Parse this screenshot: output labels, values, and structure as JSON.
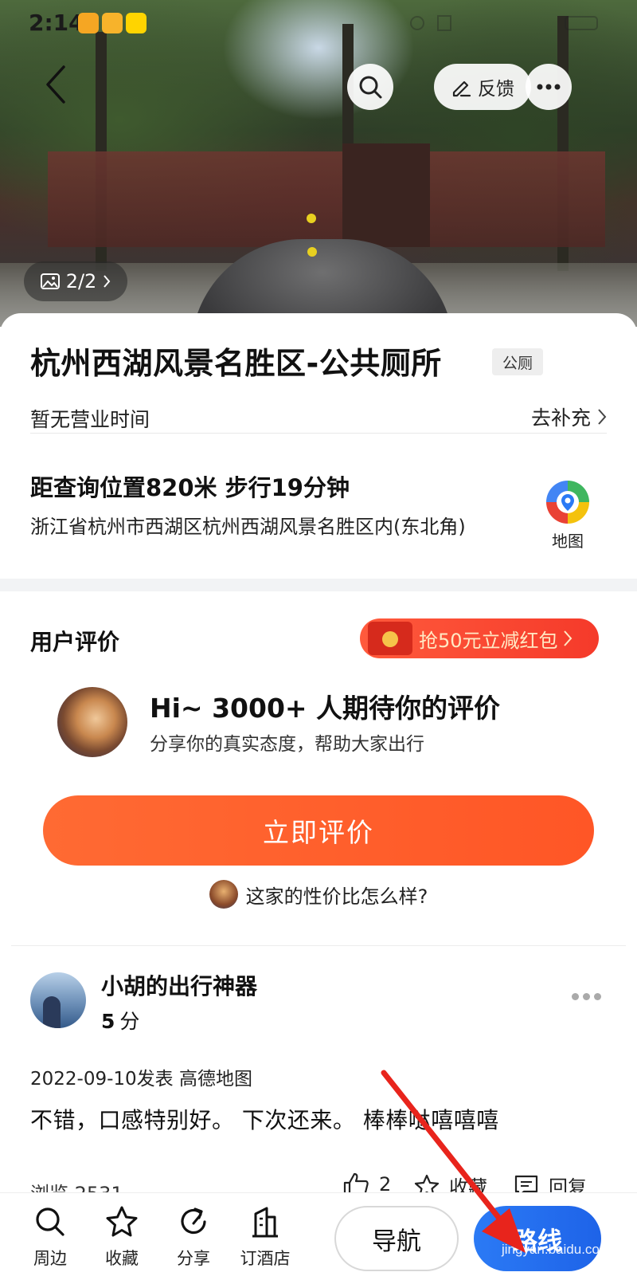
{
  "status_bar": {
    "time": "2:14",
    "app_badges": [
      {
        "icon": "message-app-icon",
        "color": "#f5a623"
      },
      {
        "icon": "delivery-app-icon",
        "color": "#f5a623"
      },
      {
        "icon": "xianyu-app-icon",
        "color": "#ffd400"
      }
    ]
  },
  "hero": {
    "photo_counter": "2/2",
    "feedback_label": "反馈"
  },
  "poi": {
    "title": "杭州西湖风景名胜区-公共厕所",
    "tag": "公厕",
    "hours": "暂无营业时间",
    "supplement_label": "去补充",
    "distance": "距查询位置820米  步行19分钟",
    "address": "浙江省杭州市西湖区杭州西湖风景名胜区内(东北角)",
    "map_label": "地图"
  },
  "reviews": {
    "heading": "用户评价",
    "promo_label": "抢50元立减红包",
    "invite_title": "Hi~ 3000+ 人期待你的评价",
    "invite_subtitle": "分享你的真实态度，帮助大家出行",
    "review_button": "立即评价",
    "question": "这家的性价比怎么样?",
    "items": [
      {
        "user": "小胡的出行神器",
        "score": "5",
        "score_unit": "分",
        "date_source": "2022-09-10发表  高德地图",
        "text": "不错，口感特别好。 下次还来。 棒棒哒嘻嘻嘻",
        "views": "浏览 2531",
        "likes": "2",
        "favorite_label": "收藏",
        "reply_label": "回复"
      }
    ]
  },
  "bottom_bar": {
    "tools": [
      {
        "label": "周边",
        "icon": "search-icon"
      },
      {
        "label": "收藏",
        "icon": "star-icon"
      },
      {
        "label": "分享",
        "icon": "share-icon"
      },
      {
        "label": "订酒店",
        "icon": "hotel-icon"
      }
    ],
    "navigate_label": "导航",
    "route_label": "路线"
  },
  "colors": {
    "accent_orange": "#ff5a2a",
    "route_blue": "#2270f0",
    "annotation_red": "#e8241c"
  },
  "watermark": "jingyan.baidu.com"
}
